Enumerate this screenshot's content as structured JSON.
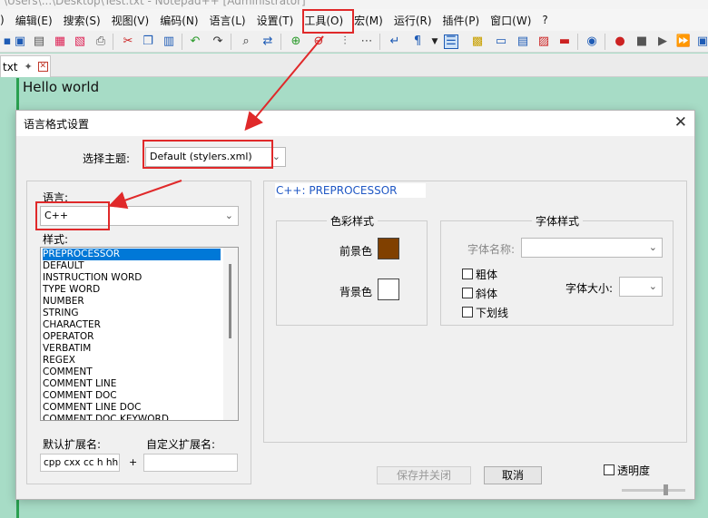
{
  "window": {
    "title_partial": "\\Users\\...\\Desktop\\Test.txt - Notepad++ [Administrator]"
  },
  "menu": [
    {
      "key": "file",
      "label": ")"
    },
    {
      "key": "edit",
      "label": "编辑(E)"
    },
    {
      "key": "search",
      "label": "搜索(S)"
    },
    {
      "key": "view",
      "label": "视图(V)"
    },
    {
      "key": "encoding",
      "label": "编码(N)"
    },
    {
      "key": "language",
      "label": "语言(L)"
    },
    {
      "key": "settings",
      "label": "设置(T)"
    },
    {
      "key": "tools",
      "label": "工具(O)"
    },
    {
      "key": "macro",
      "label": "宏(M)"
    },
    {
      "key": "run",
      "label": "运行(R)"
    },
    {
      "key": "plugins",
      "label": "插件(P)"
    },
    {
      "key": "window",
      "label": "窗口(W)"
    },
    {
      "key": "help",
      "label": "?"
    }
  ],
  "tab": {
    "label": "txt"
  },
  "editor": {
    "text": "Hello world"
  },
  "dialog": {
    "title": "语言格式设置",
    "close_glyph": "✕",
    "theme_label": "选择主题:",
    "theme_value": "Default (stylers.xml)",
    "language_label": "语言:",
    "language_value": "C++",
    "style_label": "样式:",
    "styles": [
      "PREPROCESSOR",
      "DEFAULT",
      "INSTRUCTION WORD",
      "TYPE WORD",
      "NUMBER",
      "STRING",
      "CHARACTER",
      "OPERATOR",
      "VERBATIM",
      "REGEX",
      "COMMENT",
      "COMMENT LINE",
      "COMMENT DOC",
      "COMMENT LINE DOC",
      "COMMENT DOC KEYWORD"
    ],
    "selected_style": "PREPROCESSOR",
    "default_ext_label": "默认扩展名:",
    "default_ext_value": "cpp cxx cc h hh h",
    "plus": "+",
    "user_ext_label": "自定义扩展名:",
    "user_ext_value": "",
    "style_title": "C++: PREPROCESSOR",
    "colour_group": "色彩样式",
    "fg_label": "前景色",
    "bg_label": "背景色",
    "fg_color": "#804000",
    "bg_color": "#ffffff",
    "font_group": "字体样式",
    "font_name_label": "字体名称:",
    "font_name_value": "",
    "bold_label": "粗体",
    "italic_label": "斜体",
    "underline_label": "下划线",
    "font_size_label": "字体大小:",
    "font_size_value": "",
    "save_close": "保存并关闭",
    "cancel": "取消",
    "transparency_label": "透明度"
  },
  "colors": {
    "editor_bg": "#a7dcc6",
    "selection": "#0078d7",
    "annotation": "#e0292a",
    "style_title_text": "#1f57c4"
  }
}
